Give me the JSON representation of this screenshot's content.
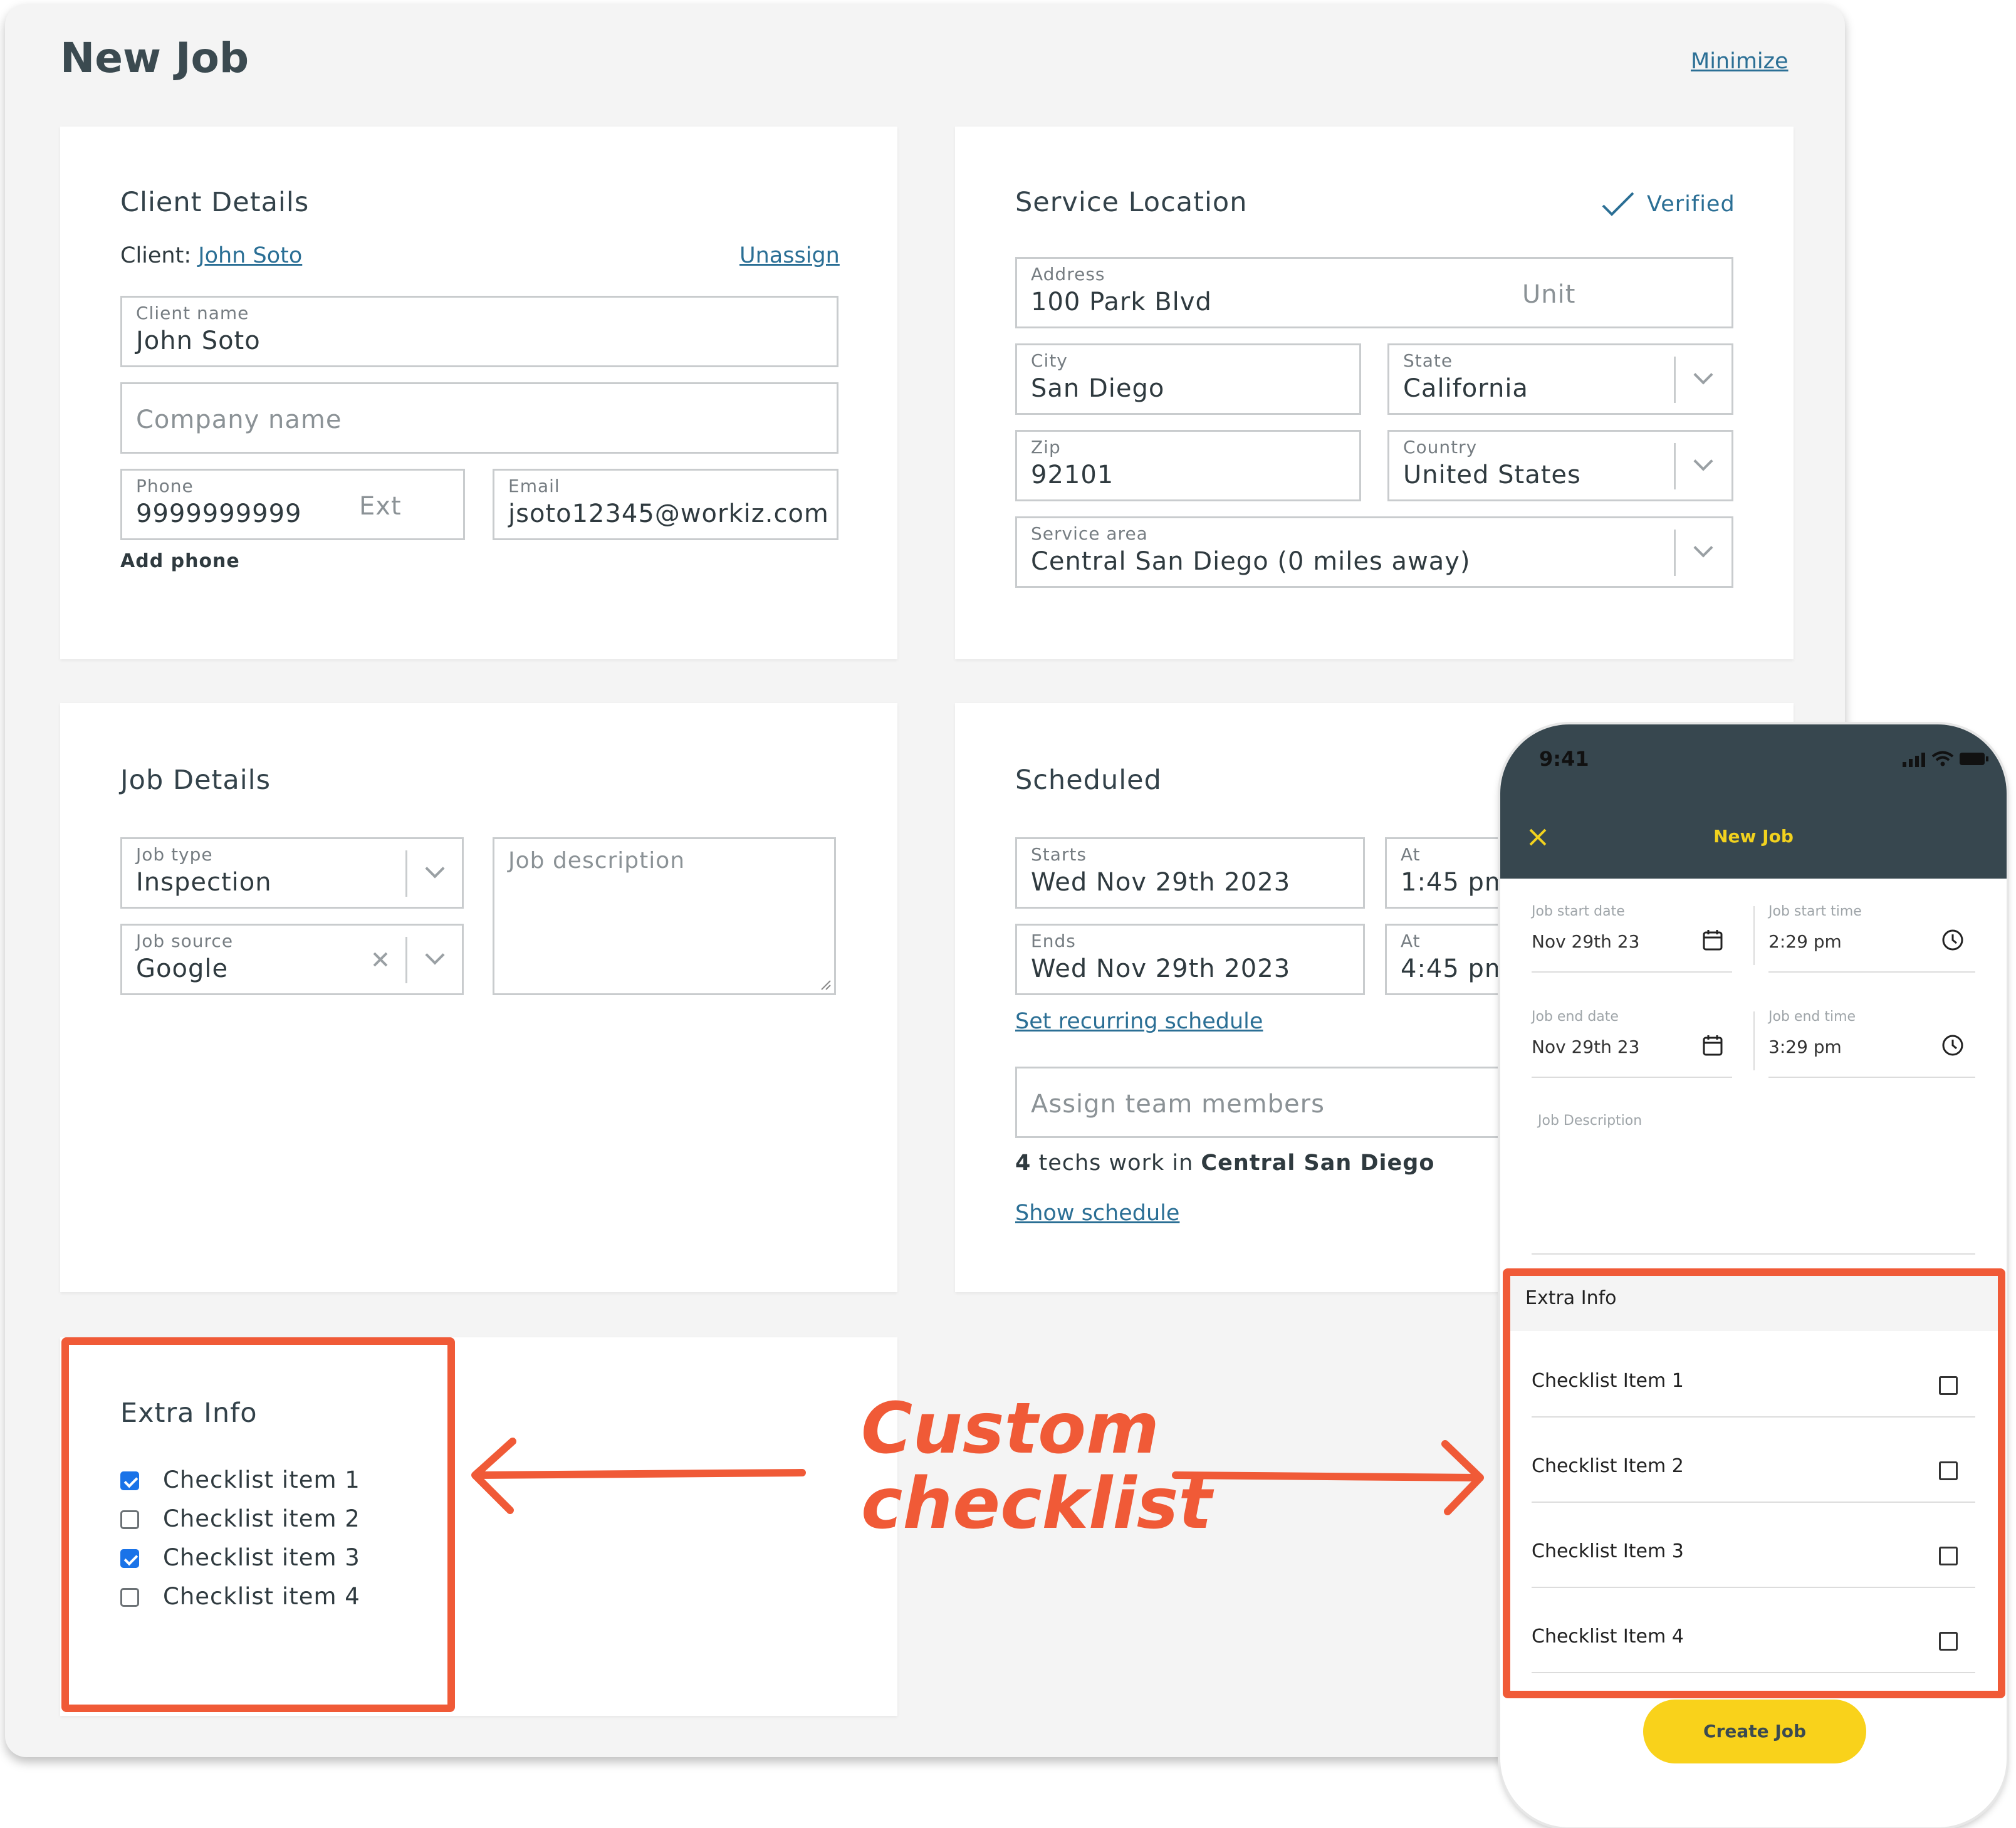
{
  "window": {
    "title": "New Job",
    "minimize_label": "Minimize"
  },
  "client_details": {
    "title": "Client Details",
    "client_prefix": "Client:",
    "client_link": "John Soto",
    "unassign_label": "Unassign",
    "client_name": {
      "label": "Client name",
      "value": "John Soto"
    },
    "company_name": {
      "placeholder": "Company name"
    },
    "phone": {
      "label": "Phone",
      "value": "9999999999",
      "ext_placeholder": "Ext"
    },
    "email": {
      "label": "Email",
      "value": "jsoto12345@workiz.com"
    },
    "add_phone_label": "Add phone"
  },
  "service_location": {
    "title": "Service Location",
    "verified_label": "Verified",
    "address": {
      "label": "Address",
      "value": "100 Park Blvd",
      "unit_placeholder": "Unit"
    },
    "city": {
      "label": "City",
      "value": "San Diego"
    },
    "state": {
      "label": "State",
      "value": "California"
    },
    "zip": {
      "label": "Zip",
      "value": "92101"
    },
    "country": {
      "label": "Country",
      "value": "United States"
    },
    "service_area": {
      "label": "Service area",
      "value": "Central San Diego (0 miles away)"
    }
  },
  "job_details": {
    "title": "Job Details",
    "job_type": {
      "label": "Job type",
      "value": "Inspection"
    },
    "job_source": {
      "label": "Job source",
      "value": "Google"
    },
    "job_description": {
      "placeholder": "Job description"
    }
  },
  "scheduled": {
    "title": "Scheduled",
    "starts": {
      "label": "Starts",
      "value": "Wed Nov 29th 2023"
    },
    "starts_at": {
      "label": "At",
      "value": "1:45 pm"
    },
    "ends": {
      "label": "Ends",
      "value": "Wed Nov 29th 2023"
    },
    "ends_at": {
      "label": "At",
      "value": "4:45 pm"
    },
    "recurring_label": "Set recurring schedule",
    "assign_placeholder": "Assign team members",
    "techs_count": "4",
    "techs_middle": "techs work in",
    "techs_area": "Central San Diego",
    "show_schedule_label": "Show schedule"
  },
  "extra_info": {
    "title": "Extra Info",
    "items": [
      {
        "label": "Checklist item 1",
        "checked": true
      },
      {
        "label": "Checklist item 2",
        "checked": false
      },
      {
        "label": "Checklist item 3",
        "checked": true
      },
      {
        "label": "Checklist item 4",
        "checked": false
      }
    ]
  },
  "annotation": {
    "line1": "Custom",
    "line2": "checklist"
  },
  "phone": {
    "status_time": "9:41",
    "title": "New Job",
    "job_start_date": {
      "label": "Job start date",
      "value": "Nov 29th 23"
    },
    "job_start_time": {
      "label": "Job start time",
      "value": "2:29 pm"
    },
    "job_end_date": {
      "label": "Job end date",
      "value": "Nov 29th 23"
    },
    "job_end_time": {
      "label": "Job end time",
      "value": "3:29 pm"
    },
    "job_description_label": "Job Description",
    "extra_info_title": "Extra Info",
    "items": [
      {
        "label": "Checklist Item 1",
        "checked": false
      },
      {
        "label": "Checklist Item 2",
        "checked": false
      },
      {
        "label": "Checklist Item 3",
        "checked": false
      },
      {
        "label": "Checklist Item 4",
        "checked": false
      }
    ],
    "create_label": "Create Job"
  },
  "colors": {
    "accent_red": "#f05a37",
    "link_blue": "#2b6f95",
    "checkbox_blue": "#1a73e8",
    "phone_header": "#37474f",
    "phone_button": "#f9d21b",
    "phone_title_yellow": "#f2d21e"
  }
}
